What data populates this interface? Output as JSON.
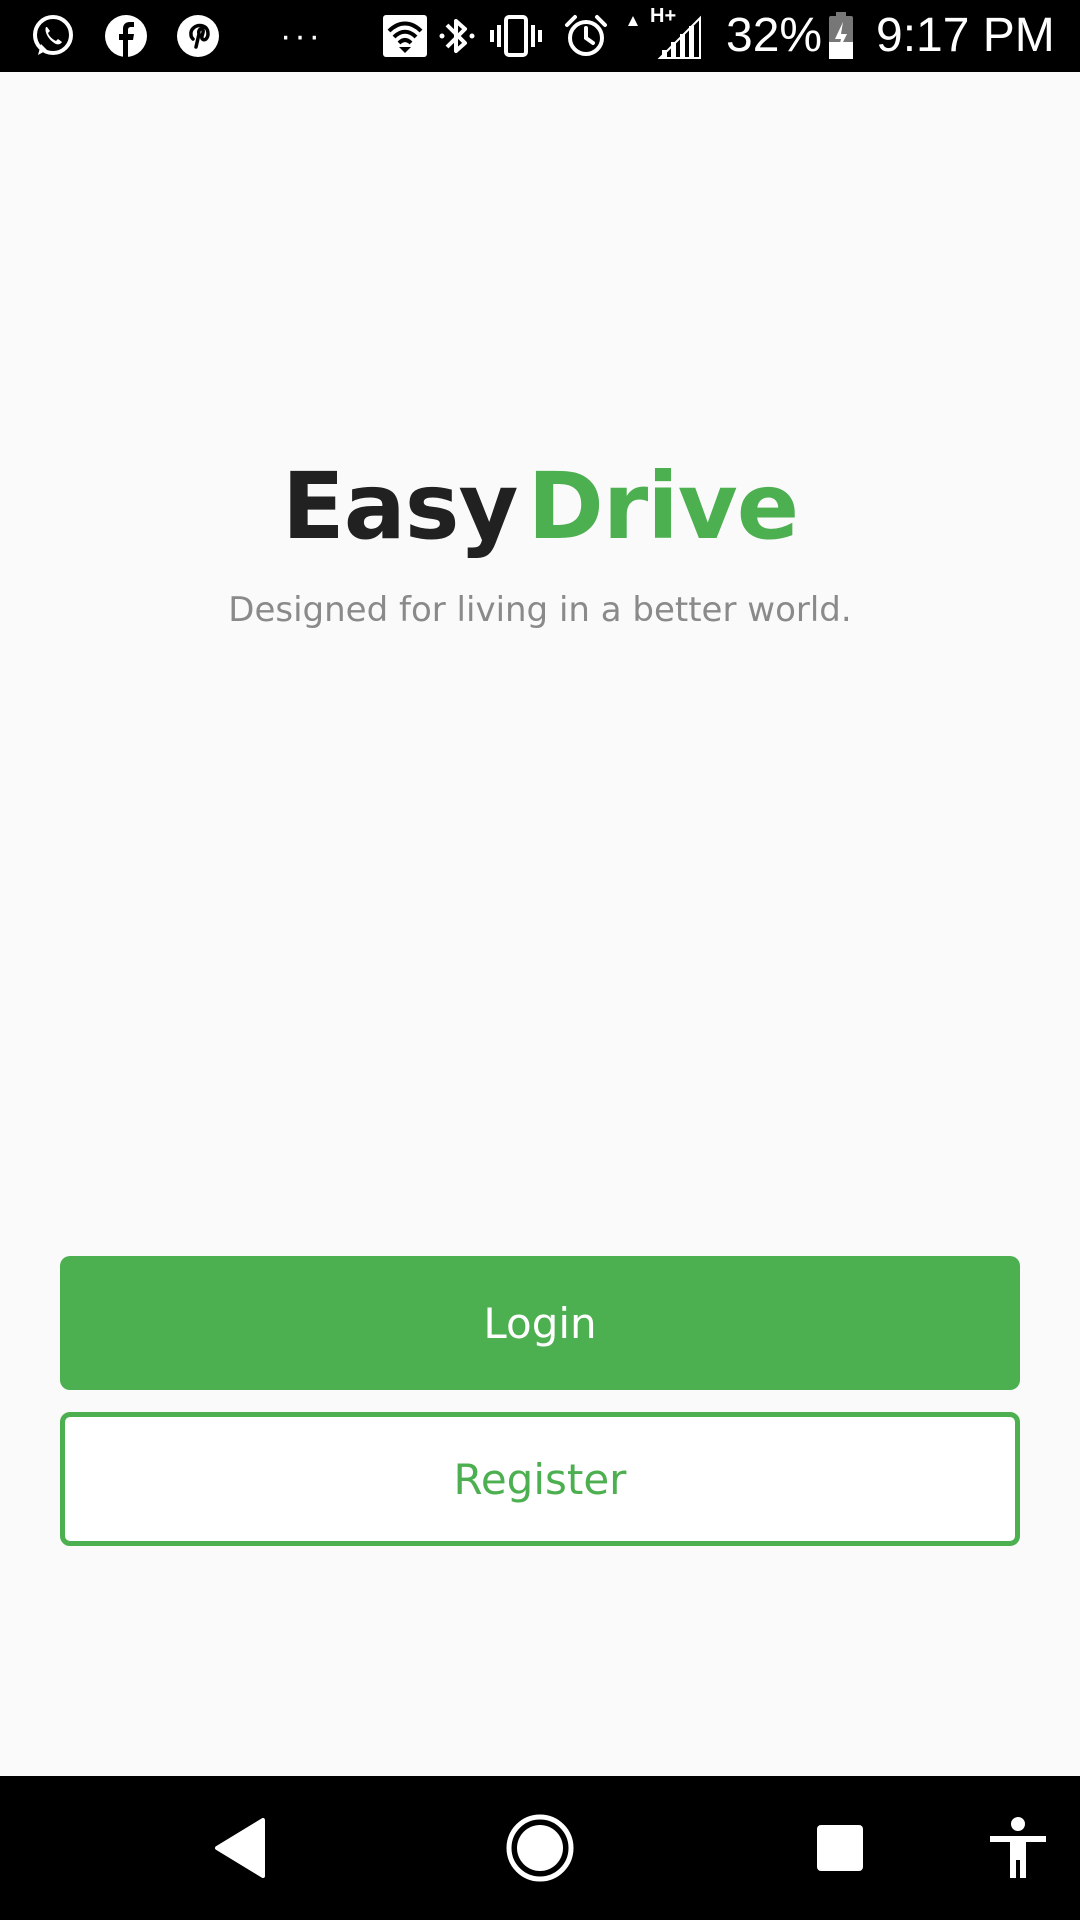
{
  "status_bar": {
    "battery": "32%",
    "time": "9:17 PM",
    "more_indicator": "···",
    "network_type": "H+",
    "left_icons": [
      "whatsapp-icon",
      "facebook-icon",
      "pinterest-icon"
    ],
    "right_icons": [
      "wifi-icon",
      "bluetooth-icon",
      "vibrate-icon",
      "alarm-icon",
      "signal-icon",
      "battery-icon"
    ]
  },
  "brand": {
    "part1": "Easy",
    "part2": "Drive",
    "tagline": "Designed for living in a better world."
  },
  "buttons": {
    "login_label": "Login",
    "register_label": "Register"
  },
  "nav_bar": {
    "icons": [
      "back-icon",
      "home-icon",
      "recents-icon",
      "accessibility-icon"
    ]
  },
  "colors": {
    "accent": "#4caf50",
    "background": "#fafafa",
    "brand_dark": "#212121",
    "tagline": "#8a8a8a"
  }
}
